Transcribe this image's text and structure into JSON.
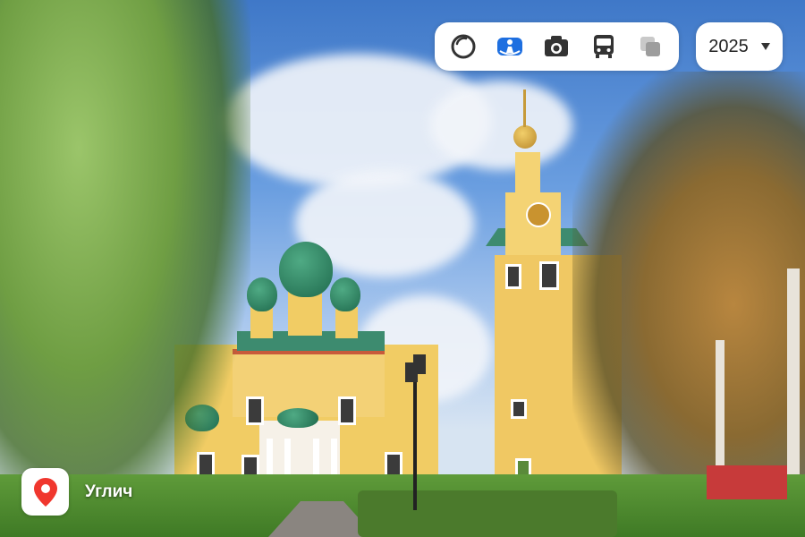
{
  "location": {
    "name": "Углич",
    "icon": "map-pin-icon",
    "icon_color": "#f0372e"
  },
  "toolbar": {
    "buttons": [
      {
        "icon": "circle-outline-icon",
        "active": false
      },
      {
        "icon": "panorama-person-icon",
        "active": true,
        "color": "#1e6fe0"
      },
      {
        "icon": "camera-icon",
        "active": false
      },
      {
        "icon": "bus-icon",
        "active": false
      },
      {
        "icon": "layers-icon",
        "active": false,
        "disabled": true
      }
    ]
  },
  "year_selector": {
    "value": "2025"
  }
}
